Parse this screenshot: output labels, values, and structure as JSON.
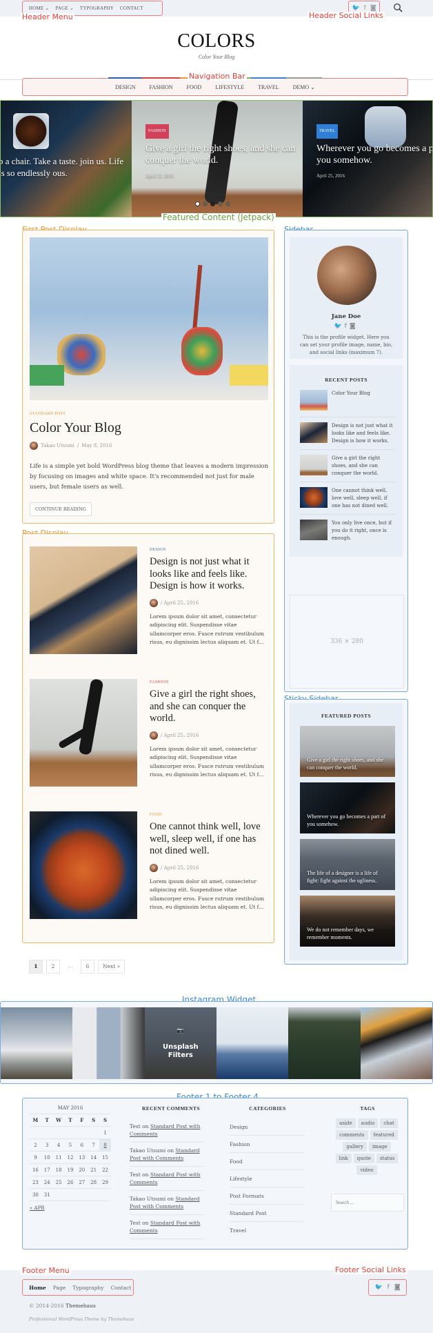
{
  "annotations": {
    "header_menu": "Header Menu",
    "header_social": "Header Social Links",
    "navigation_bar": "Navigation Bar",
    "featured_content": "Featured Content (Jetpack)",
    "first_post": "First Post Display",
    "post_display": "Post Display",
    "sidebar": "Sidebar",
    "sticky_sidebar": "Sticky Sidebar",
    "instagram": "Instagram Widget",
    "footer_widgets": "Footer 1 to Footer 4",
    "footer_menu": "Footer Menu",
    "footer_social": "Footer Social Links"
  },
  "header": {
    "menu": [
      "HOME ⌄",
      "PAGE ⌄",
      "TYPOGRAPHY",
      "CONTACT"
    ],
    "social_icons": [
      "twitter-icon",
      "facebook-icon",
      "instagram-icon"
    ],
    "social_glyphs": [
      "🐦",
      "f",
      "◙"
    ],
    "search_glyph": "⚲",
    "site_title": "COLORS",
    "tagline": "Color Your Blog"
  },
  "nav": {
    "items": [
      {
        "label": "DESIGN",
        "color": "#2f5fae"
      },
      {
        "label": "FASHION",
        "color": "#d94040"
      },
      {
        "label": "FOOD",
        "color": "#e8963a"
      },
      {
        "label": "LIFESTYLE",
        "color": "#8aa86a"
      },
      {
        "label": "TRAVEL",
        "color": "#3a7fd0"
      },
      {
        "label": "DEMO ⌄",
        "color": "#999999"
      }
    ]
  },
  "featured": {
    "slides": [
      {
        "title": "p a chair. Take a taste. join us. Life is so endlessly ous.",
        "category": "",
        "date": "",
        "badge_color": ""
      },
      {
        "title": "Give a girl the right shoes, and she can conquer the world.",
        "category": "FASHION",
        "date": "April 25, 2016",
        "badge_color": "#d2405a"
      },
      {
        "title": "Wherever you go becomes a part of you somehow.",
        "category": "TRAVEL",
        "date": "April 25, 2016",
        "badge_color": "#2f7fd6"
      }
    ],
    "dots": 5,
    "active_dot": 0
  },
  "first_post": {
    "category": "STANDARD POST",
    "title": "Color Your Blog",
    "author": "Takao Utsumi",
    "date": "May 8, 2016",
    "excerpt": "Life is a simple yet bold WordPress blog theme that leaves a modern impression by focusing on images and white space. It's recommended not just for male users, but female users as well.",
    "button": "CONTINUE READING"
  },
  "posts": [
    {
      "category": "DESIGN",
      "category_color": "#4b6ea5",
      "title": "Design is not just what it looks like and feels like. Design is how it works.",
      "date": "/ April 25, 2016",
      "excerpt": "Lorem ipsum dolor sit amet, consectetur adipiscing elit. Suspendisse vitae ullamcorper eros. Fusce rutrum vestibulum risus, eu dignissim lectus aliquam et. Ut f..."
    },
    {
      "category": "FASHION",
      "category_color": "#d9534f",
      "title": "Give a girl the right shoes, and she can conquer the world.",
      "date": "/ April 25, 2016",
      "excerpt": "Lorem ipsum dolor sit amet, consectetur adipiscing elit. Suspendisse vitae ullamcorper eros. Fusce rutrum vestibulum risus, eu dignissim lectus aliquam et. Ut f..."
    },
    {
      "category": "FOOD",
      "category_color": "#e8963a",
      "title": "One cannot think well, love well, sleep well, if one has not dined well.",
      "date": "/ April 25, 2016",
      "excerpt": "Lorem ipsum dolor sit amet, consectetur adipiscing elit. Suspendisse vitae ullamcorper eros. Fusce rutrum vestibulum risus, eu dignissim lectus aliquam et. Ut f..."
    }
  ],
  "pagination": {
    "pages": [
      "1",
      "2",
      "…",
      "6",
      "Next »"
    ],
    "current": "1"
  },
  "sidebar": {
    "profile": {
      "name": "Jane Doe",
      "social_glyphs": "🐦 f ◙",
      "bio": "This is the profile widget. Here you can set your profile image, name, bio, and social links (maximum 7)."
    },
    "recent_title": "RECENT POSTS",
    "recent": [
      "Color Your Blog",
      "Design is not just what it looks like and feels like. Design is how it works.",
      "Give a girl the right shoes, and she can conquer the world.",
      "One cannot think well, love well, sleep well, if one has not dined well.",
      "You only live once, but if you do it right, once is enough."
    ],
    "ad_placeholder": "336 × 280"
  },
  "sticky": {
    "title": "FEATURED POSTS",
    "items": [
      "Give a girl the right shoes, and she can conquer the world.",
      "Wherever you go becomes a part of you somehow.",
      "The life of a designer is a life of fight: fight against the ugliness.",
      "We do not remember days, we remember moments."
    ]
  },
  "instagram": {
    "overlay_title": "Unsplash Filters",
    "camera_glyph": "📷"
  },
  "footer_widgets": {
    "calendar": {
      "title": "MAY 2016",
      "weekdays": [
        "M",
        "T",
        "W",
        "T",
        "F",
        "S",
        "S"
      ],
      "weeks": [
        [
          "",
          "",
          "",
          "",
          "",
          "",
          "1"
        ],
        [
          "2",
          "3",
          "4",
          "5",
          "6",
          "7",
          "8"
        ],
        [
          "9",
          "10",
          "11",
          "12",
          "13",
          "14",
          "15"
        ],
        [
          "16",
          "17",
          "18",
          "19",
          "20",
          "21",
          "22"
        ],
        [
          "23",
          "24",
          "25",
          "26",
          "27",
          "28",
          "29"
        ],
        [
          "30",
          "31",
          "",
          "",
          "",
          "",
          ""
        ]
      ],
      "today": "8",
      "prev": "« APR"
    },
    "comments_title": "RECENT COMMENTS",
    "comments": [
      {
        "author": "Test",
        "on": "on",
        "post": "Standard Post with Comments"
      },
      {
        "author": "Takao Utsumi",
        "on": "on",
        "post": "Standard Post with Comments"
      },
      {
        "author": "Test",
        "on": "on",
        "post": "Standard Post with Comments"
      },
      {
        "author": "Takao Utsumi",
        "on": "on",
        "post": "Standard Post with Comments"
      },
      {
        "author": "Test",
        "on": "on",
        "post": "Standard Post with Comments"
      }
    ],
    "categories_title": "CATEGORIES",
    "categories": [
      "Design",
      "Fashion",
      "Food",
      "Lifestyle",
      "Post Formats",
      "Standard Post",
      "Travel"
    ],
    "tags_title": "TAGS",
    "tags": [
      "aside",
      "audio",
      "chat",
      "comments",
      "featured",
      "gallery",
      "image",
      "link",
      "quote",
      "status",
      "video"
    ],
    "search_placeholder": "Search ..."
  },
  "footer": {
    "menu": [
      "Home",
      "Page",
      "Typography",
      "Contact"
    ],
    "social_glyphs": [
      "🐦",
      "f",
      "◙"
    ],
    "copyright": "© 2014-2016",
    "copyright_owner": "Themehaus",
    "credit": "Professional WordPress Theme by Themehaus"
  }
}
